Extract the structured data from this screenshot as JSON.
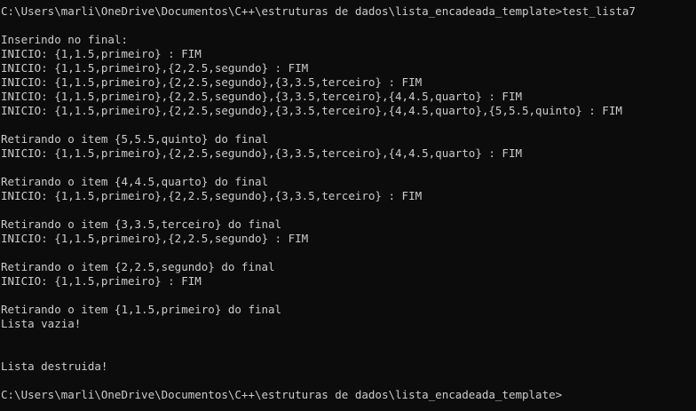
{
  "console": {
    "lines": [
      "C:\\Users\\marli\\OneDrive\\Documentos\\C++\\estruturas de dados\\lista_encadeada_template>test_lista7",
      "",
      "Inserindo no final:",
      "INICIO: {1,1.5,primeiro} : FIM",
      "INICIO: {1,1.5,primeiro},{2,2.5,segundo} : FIM",
      "INICIO: {1,1.5,primeiro},{2,2.5,segundo},{3,3.5,terceiro} : FIM",
      "INICIO: {1,1.5,primeiro},{2,2.5,segundo},{3,3.5,terceiro},{4,4.5,quarto} : FIM",
      "INICIO: {1,1.5,primeiro},{2,2.5,segundo},{3,3.5,terceiro},{4,4.5,quarto},{5,5.5,quinto} : FIM",
      "",
      "Retirando o item {5,5.5,quinto} do final",
      "INICIO: {1,1.5,primeiro},{2,2.5,segundo},{3,3.5,terceiro},{4,4.5,quarto} : FIM",
      "",
      "Retirando o item {4,4.5,quarto} do final",
      "INICIO: {1,1.5,primeiro},{2,2.5,segundo},{3,3.5,terceiro} : FIM",
      "",
      "Retirando o item {3,3.5,terceiro} do final",
      "INICIO: {1,1.5,primeiro},{2,2.5,segundo} : FIM",
      "",
      "Retirando o item {2,2.5,segundo} do final",
      "INICIO: {1,1.5,primeiro} : FIM",
      "",
      "Retirando o item {1,1.5,primeiro} do final",
      "Lista vazia!",
      "",
      "",
      "Lista destruida!",
      "",
      "C:\\Users\\marli\\OneDrive\\Documentos\\C++\\estruturas de dados\\lista_encadeada_template>"
    ]
  },
  "colors": {
    "background": "#0c0c0c",
    "text": "#cccccc"
  }
}
